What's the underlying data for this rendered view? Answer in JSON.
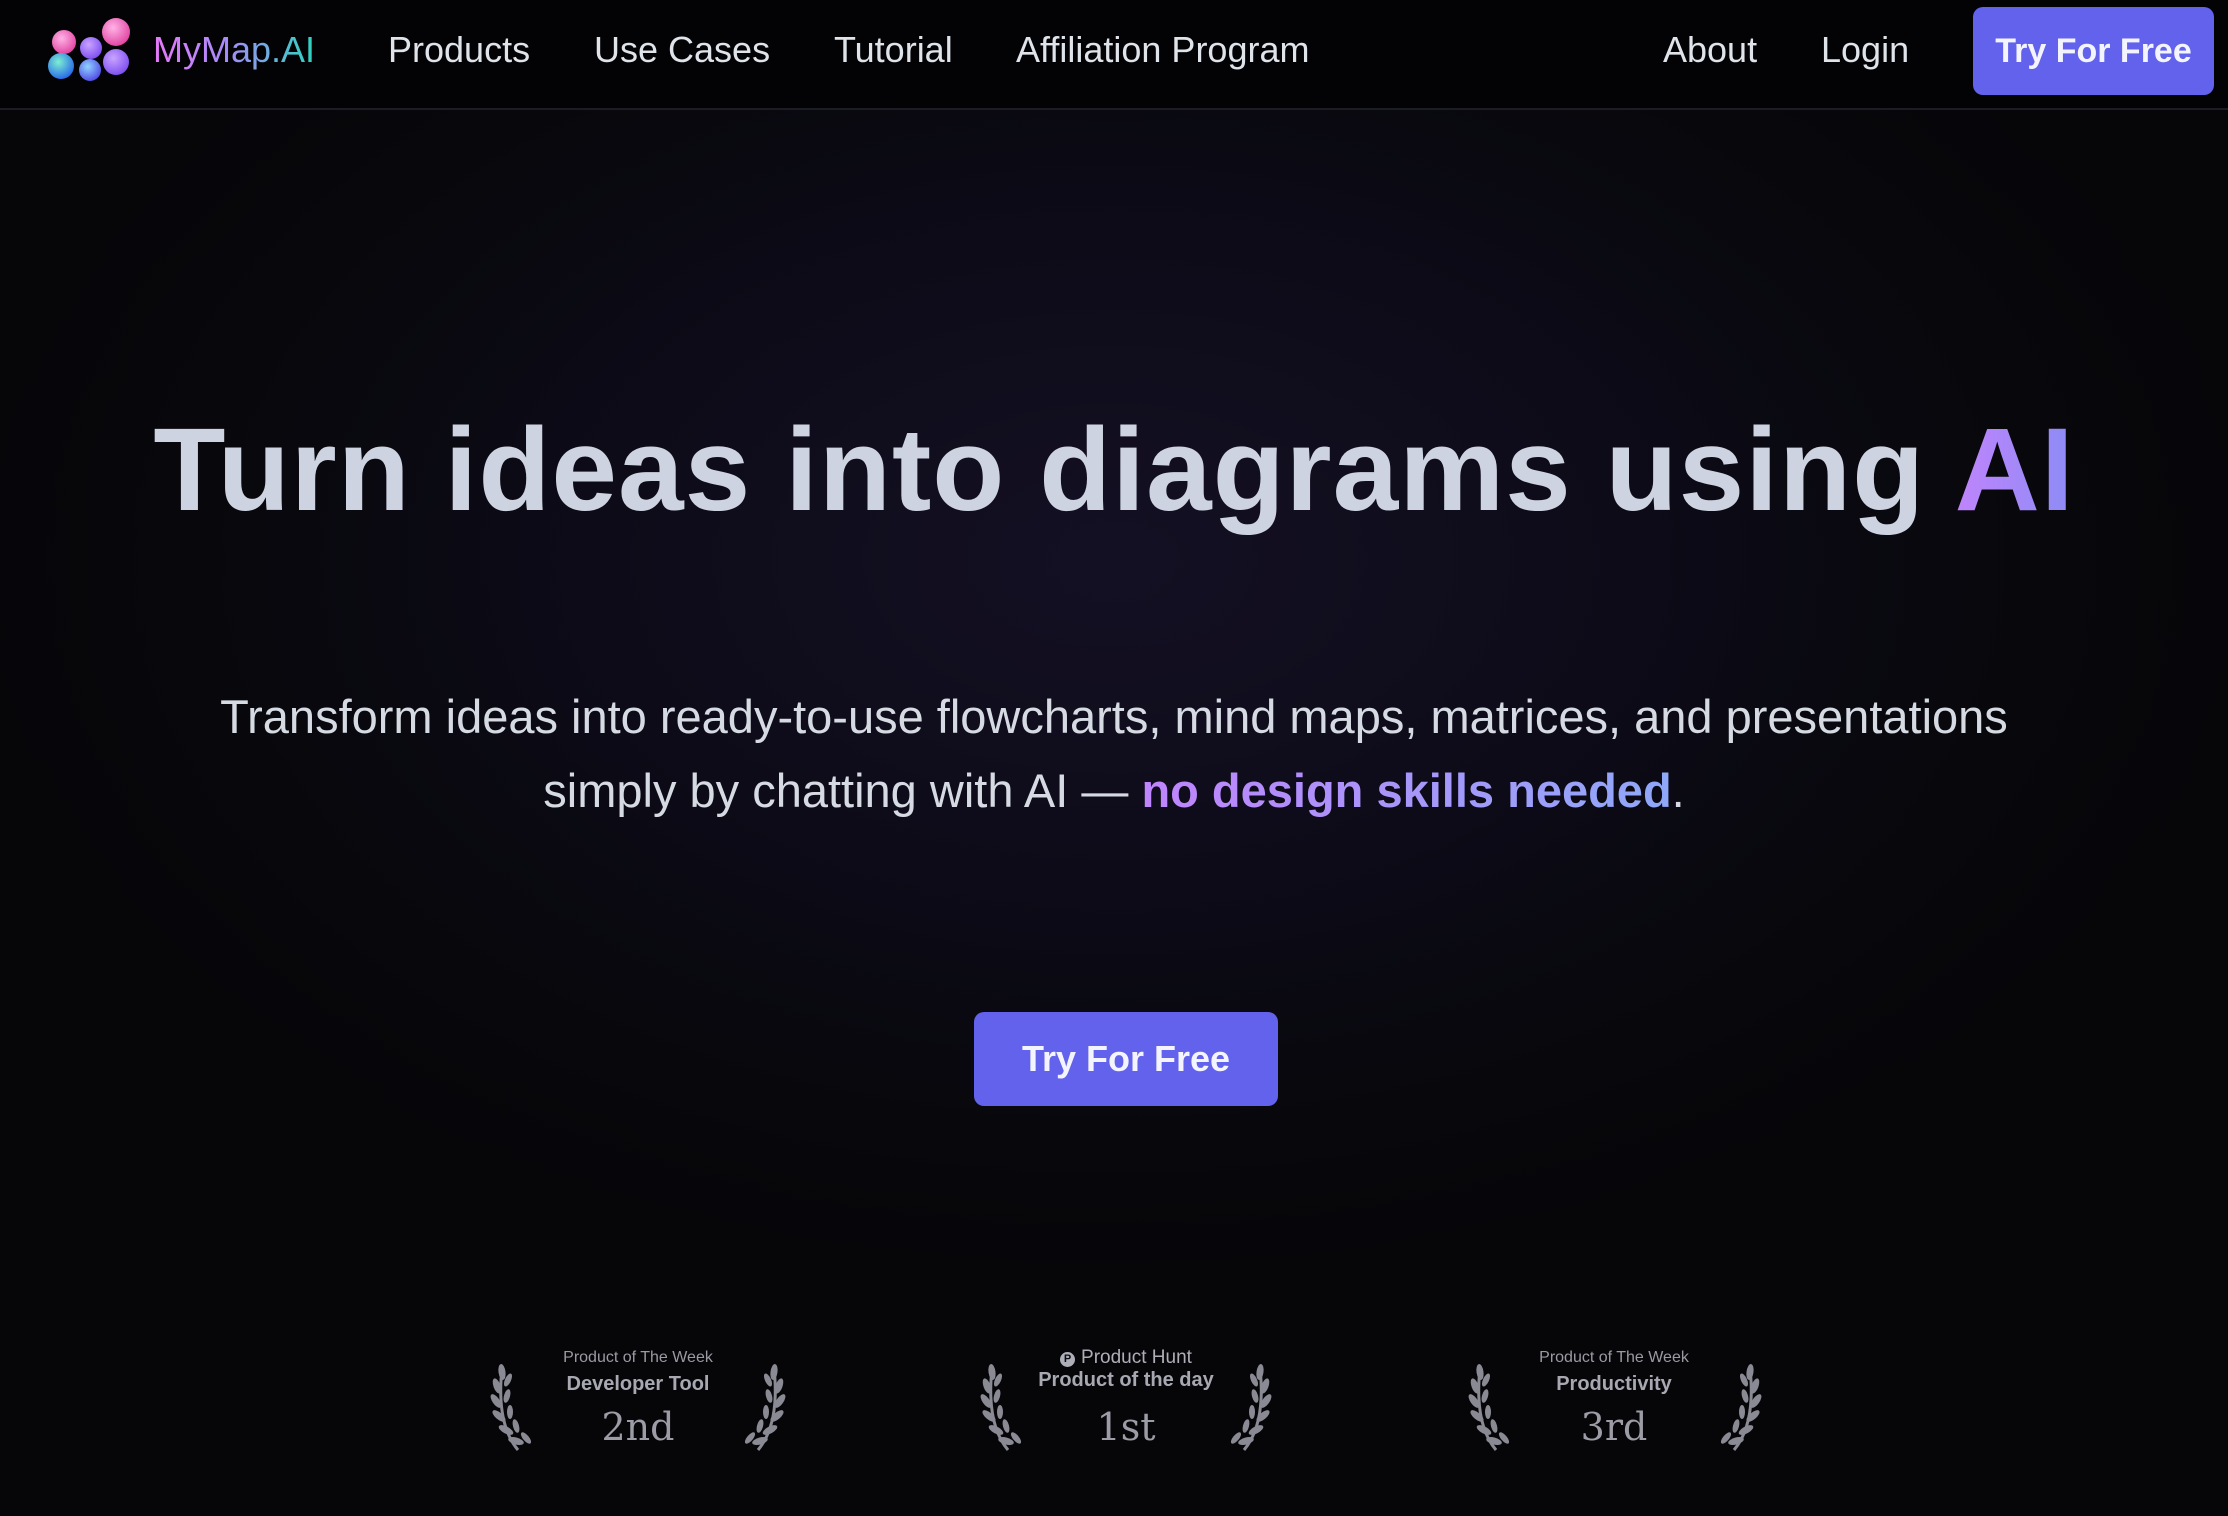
{
  "nav": {
    "brand": "MyMap.AI",
    "links": [
      "Products",
      "Use Cases",
      "Tutorial",
      "Affiliation Program"
    ],
    "about": "About",
    "login": "Login",
    "cta": "Try For Free"
  },
  "hero": {
    "title_main": "Turn ideas into diagrams using ",
    "title_accent": "AI",
    "subtitle_line1": "Transform ideas into ready-to-use flowcharts, mind maps, matrices, and presentations",
    "subtitle_line2_prefix": "simply by chatting with AI — ",
    "subtitle_highlight": "no design skills needed",
    "subtitle_suffix": ".",
    "cta": "Try For Free"
  },
  "badges": [
    {
      "top_label": "Product of The Week",
      "category": "Developer Tool",
      "rank": "2nd"
    },
    {
      "top_label": "Product Hunt",
      "category": "Product of the day",
      "rank": "1st"
    },
    {
      "top_label": "Product of The Week",
      "category": "Productivity",
      "rank": "3rd"
    }
  ],
  "colors": {
    "accent": "#6262ec",
    "background": "#07070c",
    "gradient_start": "#c084fc",
    "gradient_end": "#8b8cf5"
  }
}
